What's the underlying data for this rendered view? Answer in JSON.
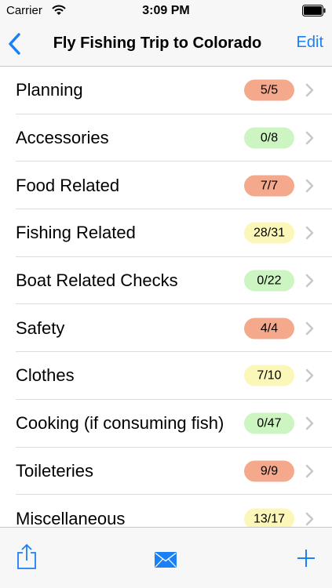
{
  "status_bar": {
    "carrier": "Carrier",
    "time": "3:09 PM",
    "wifi_icon": "wifi-icon",
    "battery_icon": "battery-icon"
  },
  "nav": {
    "back_icon": "chevron-left-icon",
    "title": "Fly Fishing Trip to Colorado",
    "edit_label": "Edit"
  },
  "colors": {
    "accent": "#1b7ff6",
    "badge_complete": "#f4a98d",
    "badge_empty": "#cdf5c1",
    "badge_partial": "#fbf7b8"
  },
  "list": {
    "items": [
      {
        "label": "Planning",
        "count": "5/5",
        "status": "complete"
      },
      {
        "label": "Accessories",
        "count": "0/8",
        "status": "empty"
      },
      {
        "label": "Food Related",
        "count": "7/7",
        "status": "complete"
      },
      {
        "label": "Fishing Related",
        "count": "28/31",
        "status": "partial"
      },
      {
        "label": "Boat Related Checks",
        "count": "0/22",
        "status": "empty"
      },
      {
        "label": "Safety",
        "count": "4/4",
        "status": "complete"
      },
      {
        "label": "Clothes",
        "count": "7/10",
        "status": "partial"
      },
      {
        "label": "Cooking (if consuming fish)",
        "count": "0/47",
        "status": "empty"
      },
      {
        "label": "Toileteries",
        "count": "9/9",
        "status": "complete"
      },
      {
        "label": "Miscellaneous",
        "count": "13/17",
        "status": "partial"
      }
    ]
  },
  "toolbar": {
    "share_icon": "share-icon",
    "mail_icon": "envelope-icon",
    "add_icon": "plus-icon"
  }
}
